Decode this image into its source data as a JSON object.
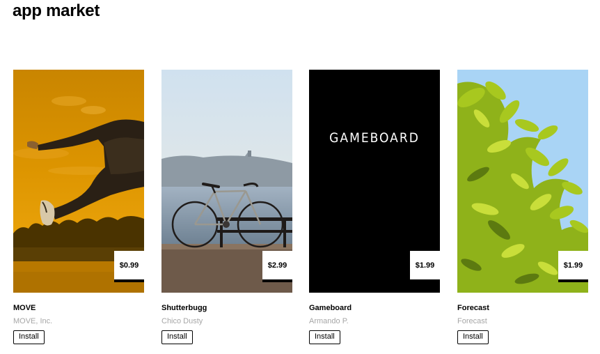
{
  "page": {
    "title": "app market"
  },
  "apps": [
    {
      "name": "MOVE",
      "developer": "MOVE, Inc.",
      "price": "$0.99",
      "install_label": "Install",
      "image": "jumping-person-photo"
    },
    {
      "name": "Shutterbugg",
      "developer": "Chico Dusty",
      "price": "$2.99",
      "install_label": "Install",
      "image": "bicycle-photo"
    },
    {
      "name": "Gameboard",
      "developer": "Armando P.",
      "price": "$1.99",
      "install_label": "Install",
      "image": "gameboard-logo",
      "image_text": "GAMEBOARD"
    },
    {
      "name": "Forecast",
      "developer": "Forecast",
      "price": "$1.99",
      "install_label": "Install",
      "image": "leaves-photo"
    }
  ],
  "colors": {
    "move_bg": "#d88f00",
    "gameboard_bg": "#000000",
    "forecast_sky": "#a9d4f5",
    "leaf_green": "#9cbf1e"
  }
}
